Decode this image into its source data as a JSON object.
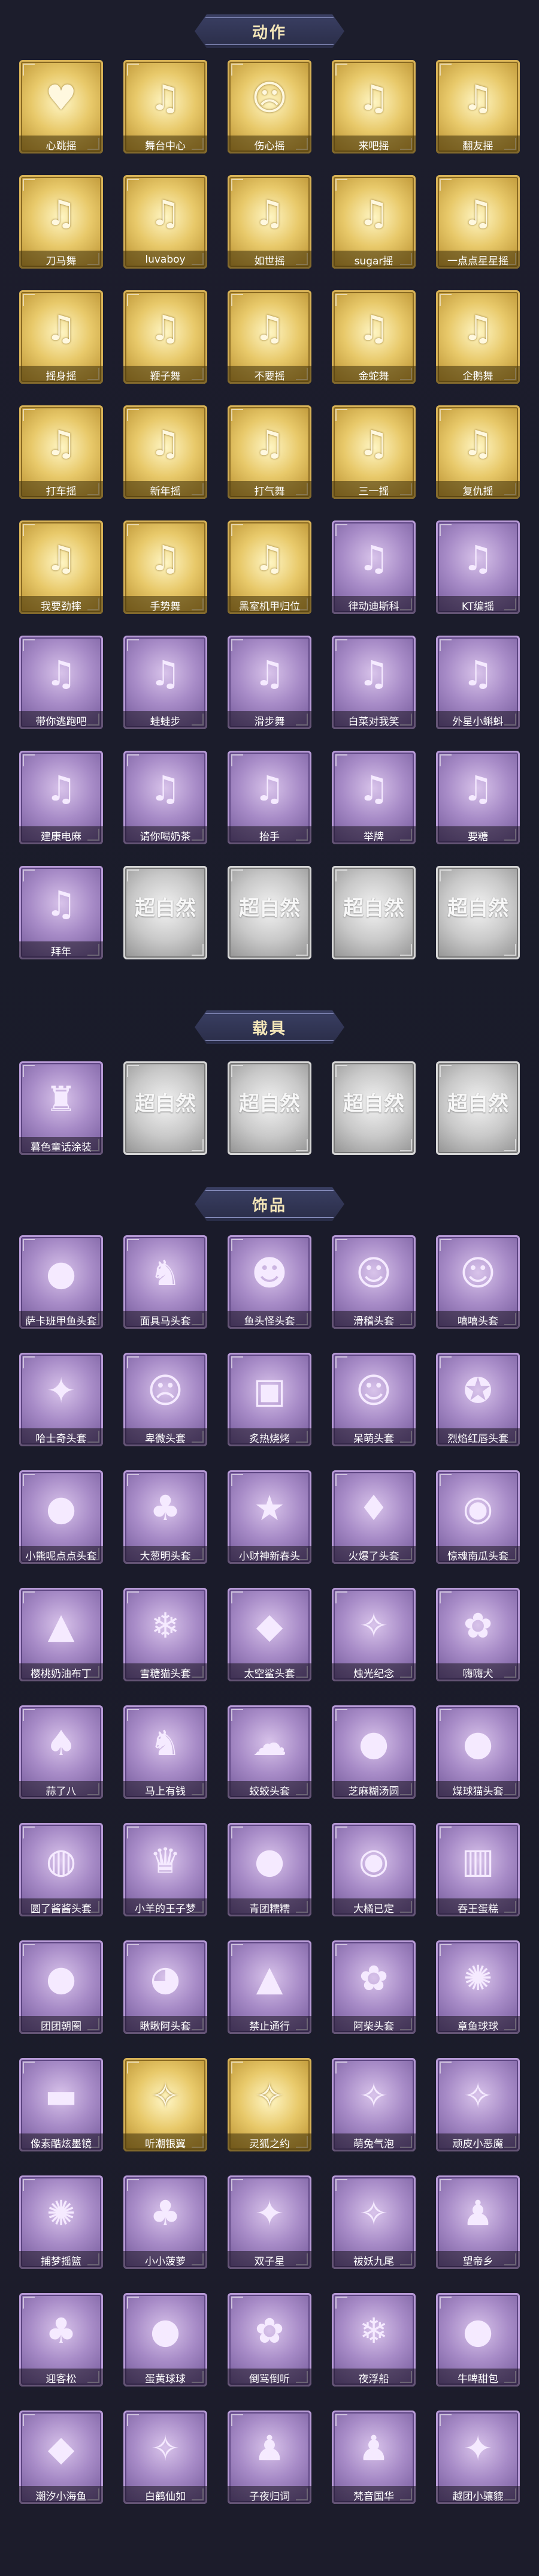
{
  "sections": {
    "actions": {
      "title": "动作",
      "items": [
        {
          "label": "心跳摇",
          "style": "gold",
          "icon": "heart-pose-figure"
        },
        {
          "label": "舞台中心",
          "style": "gold",
          "icon": "dance-figure"
        },
        {
          "label": "伤心摇",
          "style": "gold",
          "icon": "sad-figure"
        },
        {
          "label": "来吧摇",
          "style": "gold",
          "icon": "dance-figure"
        },
        {
          "label": "翻友摇",
          "style": "gold",
          "icon": "dance-figure"
        },
        {
          "label": "刀马舞",
          "style": "gold",
          "icon": "dance-figure"
        },
        {
          "label": "luvaboy",
          "style": "gold",
          "icon": "dance-figure"
        },
        {
          "label": "如世摇",
          "style": "gold",
          "icon": "dance-figure"
        },
        {
          "label": "sugar摇",
          "style": "gold",
          "icon": "dance-figure"
        },
        {
          "label": "一点点星星摇",
          "style": "gold",
          "icon": "dance-figure"
        },
        {
          "label": "摇身摇",
          "style": "gold",
          "icon": "dance-figure"
        },
        {
          "label": "鞭子舞",
          "style": "gold",
          "icon": "dance-figure"
        },
        {
          "label": "不要摇",
          "style": "gold",
          "icon": "dance-figure"
        },
        {
          "label": "金蛇舞",
          "style": "gold",
          "icon": "dance-figure"
        },
        {
          "label": "企鹅舞",
          "style": "gold",
          "icon": "dance-figure"
        },
        {
          "label": "打车摇",
          "style": "gold",
          "icon": "dance-figure"
        },
        {
          "label": "新年摇",
          "style": "gold",
          "icon": "dance-figure"
        },
        {
          "label": "打气舞",
          "style": "gold",
          "icon": "dance-figure"
        },
        {
          "label": "三一摇",
          "style": "gold",
          "icon": "dance-figure"
        },
        {
          "label": "复仇摇",
          "style": "gold",
          "icon": "dance-figure"
        },
        {
          "label": "我要劲摔",
          "style": "gold",
          "icon": "dance-figure"
        },
        {
          "label": "手势舞",
          "style": "gold",
          "icon": "dance-figure"
        },
        {
          "label": "黑室机甲归位",
          "style": "gold",
          "icon": "dance-figure"
        },
        {
          "label": "律动迪斯科",
          "style": "purple",
          "icon": "dance-figure"
        },
        {
          "label": "KT编摇",
          "style": "purple",
          "icon": "dance-figure"
        },
        {
          "label": "带你逃跑吧",
          "style": "purple",
          "icon": "dance-figure"
        },
        {
          "label": "蛙蛙步",
          "style": "purple",
          "icon": "dance-figure"
        },
        {
          "label": "滑步舞",
          "style": "purple",
          "icon": "dance-figure"
        },
        {
          "label": "白菜对我笑",
          "style": "purple",
          "icon": "dance-figure"
        },
        {
          "label": "外星小蝌蚪",
          "style": "purple",
          "icon": "dance-figure"
        },
        {
          "label": "建康电麻",
          "style": "purple",
          "icon": "dance-figure"
        },
        {
          "label": "请你喝奶茶",
          "style": "purple",
          "icon": "dance-figure"
        },
        {
          "label": "抬手",
          "style": "purple",
          "icon": "dance-figure"
        },
        {
          "label": "举牌",
          "style": "purple",
          "icon": "dance-figure"
        },
        {
          "label": "要糖",
          "style": "purple",
          "icon": "dance-figure"
        },
        {
          "label": "拜年",
          "style": "purple",
          "icon": "dance-figure"
        },
        {
          "label": "",
          "style": "gray",
          "icon": "locked-placeholder",
          "brand": "超自然"
        },
        {
          "label": "",
          "style": "gray",
          "icon": "locked-placeholder",
          "brand": "超自然"
        },
        {
          "label": "",
          "style": "gray",
          "icon": "locked-placeholder",
          "brand": "超自然"
        },
        {
          "label": "",
          "style": "gray",
          "icon": "locked-placeholder",
          "brand": "超自然"
        }
      ]
    },
    "vehicles": {
      "title": "载具",
      "items": [
        {
          "label": "暮色童话涂装",
          "style": "purple",
          "icon": "castle-vehicle"
        },
        {
          "label": "",
          "style": "gray",
          "icon": "locked-placeholder",
          "brand": "超自然"
        },
        {
          "label": "",
          "style": "gray",
          "icon": "locked-placeholder",
          "brand": "超自然"
        },
        {
          "label": "",
          "style": "gray",
          "icon": "locked-placeholder",
          "brand": "超自然"
        },
        {
          "label": "",
          "style": "gray",
          "icon": "locked-placeholder",
          "brand": "超自然"
        }
      ]
    },
    "accessories": {
      "title": "饰品",
      "items": [
        {
          "label": "萨卡班甲鱼头套",
          "style": "purple",
          "icon": "fish-head"
        },
        {
          "label": "面具马头套",
          "style": "purple",
          "icon": "horse-head"
        },
        {
          "label": "鱼头怪头套",
          "style": "purple",
          "icon": "fish-monster-head"
        },
        {
          "label": "滑稽头套",
          "style": "purple",
          "icon": "smiley-head"
        },
        {
          "label": "嘻嘻头套",
          "style": "purple",
          "icon": "grin-head"
        },
        {
          "label": "哈士奇头套",
          "style": "purple",
          "icon": "husky-head"
        },
        {
          "label": "卑微头套",
          "style": "purple",
          "icon": "worried-face-head"
        },
        {
          "label": "炙热烧烤",
          "style": "purple",
          "icon": "bbq-head"
        },
        {
          "label": "呆萌头套",
          "style": "purple",
          "icon": "dazed-face-head"
        },
        {
          "label": "烈焰红唇头套",
          "style": "purple",
          "icon": "pikachu-lips-head"
        },
        {
          "label": "小熊呢点点头套",
          "style": "purple",
          "icon": "bear-head"
        },
        {
          "label": "大葱明头套",
          "style": "purple",
          "icon": "scallion-head"
        },
        {
          "label": "小财神新春头",
          "style": "purple",
          "icon": "fortune-head"
        },
        {
          "label": "火爆了头套",
          "style": "purple",
          "icon": "fire-head"
        },
        {
          "label": "惊魂南瓜头套",
          "style": "purple",
          "icon": "pumpkin-head"
        },
        {
          "label": "樱桃奶油布丁",
          "style": "purple",
          "icon": "pudding-head"
        },
        {
          "label": "雪糖猫头套",
          "style": "purple",
          "icon": "snow-cat-head"
        },
        {
          "label": "太空鲨头套",
          "style": "purple",
          "icon": "shark-head"
        },
        {
          "label": "烛光纪念",
          "style": "purple",
          "icon": "candle-head"
        },
        {
          "label": "嗨嗨犬",
          "style": "purple",
          "icon": "dog-head"
        },
        {
          "label": "蒜了八",
          "style": "purple",
          "icon": "garlic-head"
        },
        {
          "label": "马上有钱",
          "style": "purple",
          "icon": "horse-money-head"
        },
        {
          "label": "蛟蛟头套",
          "style": "purple",
          "icon": "cloud-head"
        },
        {
          "label": "芝麻糊汤圆",
          "style": "purple",
          "icon": "dumpling-head"
        },
        {
          "label": "煤球猫头套",
          "style": "purple",
          "icon": "black-cat-head"
        },
        {
          "label": "圆了酱酱头套",
          "style": "purple",
          "icon": "round-head"
        },
        {
          "label": "小羊的王子梦",
          "style": "purple",
          "icon": "sheep-prince-head"
        },
        {
          "label": "青团糯糯",
          "style": "purple",
          "icon": "green-dumpling-head"
        },
        {
          "label": "大橘已定",
          "style": "purple",
          "icon": "orange-head"
        },
        {
          "label": "吞王蛋糕",
          "style": "purple",
          "icon": "cake-head"
        },
        {
          "label": "团团朝圈",
          "style": "purple",
          "icon": "bun-head"
        },
        {
          "label": "瞅瞅阿头套",
          "style": "purple",
          "icon": "bird-head"
        },
        {
          "label": "禁止通行",
          "style": "purple",
          "icon": "traffic-cone-head"
        },
        {
          "label": "阿柴头套",
          "style": "purple",
          "icon": "shiba-head"
        },
        {
          "label": "章鱼球球",
          "style": "purple",
          "icon": "octopus-head"
        },
        {
          "label": "像素酷炫墨镜",
          "style": "purple",
          "icon": "pixel-sunglasses"
        },
        {
          "label": "听潮银翼",
          "style": "gold",
          "icon": "silver-wings"
        },
        {
          "label": "灵狐之约",
          "style": "gold",
          "icon": "fox-accessory"
        },
        {
          "label": "萌兔气泡",
          "style": "purple",
          "icon": "bunny-bubble"
        },
        {
          "label": "顽皮小恶魔",
          "style": "purple",
          "icon": "devil-accessory"
        },
        {
          "label": "捕梦摇篮",
          "style": "purple",
          "icon": "dreamcatcher"
        },
        {
          "label": "小小菠萝",
          "style": "purple",
          "icon": "pineapple"
        },
        {
          "label": "双子星",
          "style": "purple",
          "icon": "twin-stars"
        },
        {
          "label": "祓妖九尾",
          "style": "purple",
          "icon": "nine-tail"
        },
        {
          "label": "望帝乡",
          "style": "purple",
          "icon": "figure-accessory"
        },
        {
          "label": "迎客松",
          "style": "purple",
          "icon": "pine-tree"
        },
        {
          "label": "蛋黄球球",
          "style": "purple",
          "icon": "egg-ball"
        },
        {
          "label": "倒骂倒听",
          "style": "purple",
          "icon": "rose-accessory"
        },
        {
          "label": "夜浮船",
          "style": "purple",
          "icon": "ice-flower"
        },
        {
          "label": "牛啤甜包",
          "style": "purple",
          "icon": "cow-bun"
        },
        {
          "label": "潮汐小海鱼",
          "style": "purple",
          "icon": "fish-mascot"
        },
        {
          "label": "白鹤仙如",
          "style": "purple",
          "icon": "white-crane"
        },
        {
          "label": "子夜归词",
          "style": "purple",
          "icon": "figure-accessory"
        },
        {
          "label": "梵音国华",
          "style": "purple",
          "icon": "figure-accessory"
        },
        {
          "label": "越团小骧貔",
          "style": "purple",
          "icon": "pixiu-mascot"
        }
      ]
    }
  }
}
